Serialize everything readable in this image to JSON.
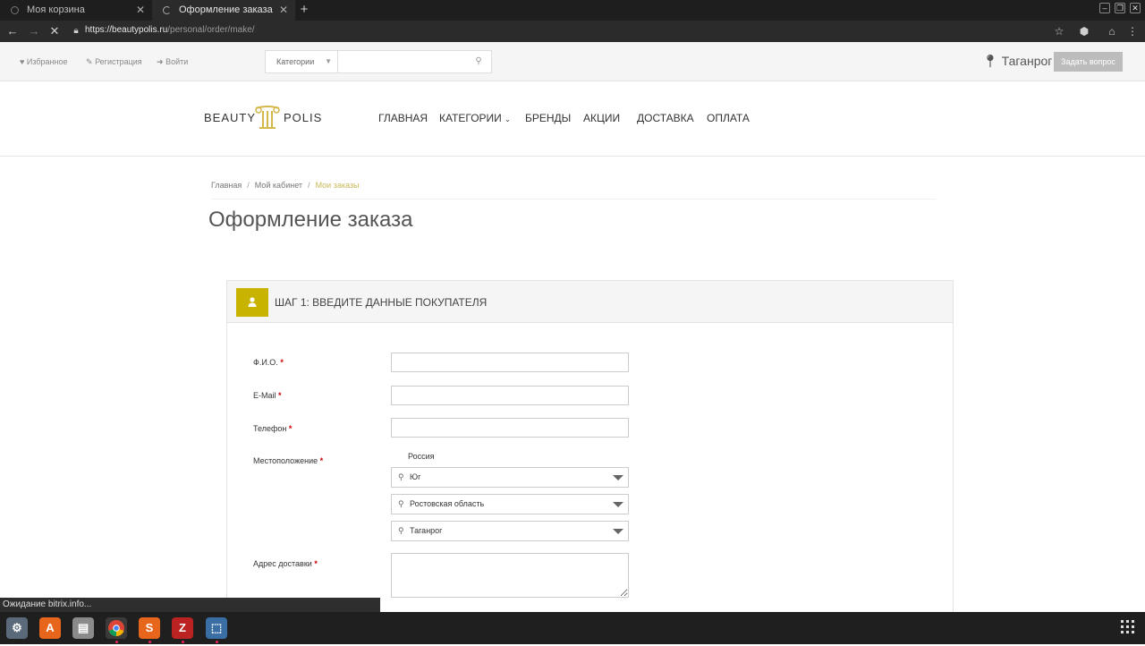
{
  "browser": {
    "tabs": [
      {
        "title": "Моя корзина",
        "active": false
      },
      {
        "title": "Оформление заказа",
        "active": true
      }
    ],
    "url_host": "https://beautypolis.ru",
    "url_path": "/personal/order/make/",
    "status_text": "Ожидание bitrix.info..."
  },
  "topbar": {
    "links": [
      "Избранное",
      "Регистрация",
      "Войти"
    ],
    "category_select": "Категории",
    "city": "Таганрог",
    "ask_button": "Задать вопрос"
  },
  "header": {
    "logo_left": "BEAUTY",
    "logo_right": "POLIS",
    "nav": [
      "ГЛАВНАЯ",
      "КАТЕГОРИИ",
      "БРЕНДЫ",
      "АКЦИИ",
      "ДОСТАВКА",
      "ОПЛАТА"
    ]
  },
  "breadcrumb": [
    "Главная",
    "Мой кабинет",
    "Мои заказы"
  ],
  "page_title": "Оформление заказа",
  "form": {
    "step_title": "ШАГ 1: ВВЕДИТЕ ДАННЫЕ ПОКУПАТЕЛЯ",
    "fields": {
      "fio": {
        "label": "Ф.И.О.",
        "value": ""
      },
      "email": {
        "label": "E-Mail",
        "value": ""
      },
      "phone": {
        "label": "Телефон",
        "value": ""
      },
      "location": {
        "label": "Местоположение",
        "country": "Россия",
        "levels": [
          "Юг",
          "Ростовская область",
          "Таганрог"
        ]
      },
      "address": {
        "label": "Адрес доставки",
        "value": ""
      }
    },
    "required_mark": "*"
  },
  "colors": {
    "accent": "#c8b400",
    "breadcrumb_current": "#c8b95a"
  }
}
